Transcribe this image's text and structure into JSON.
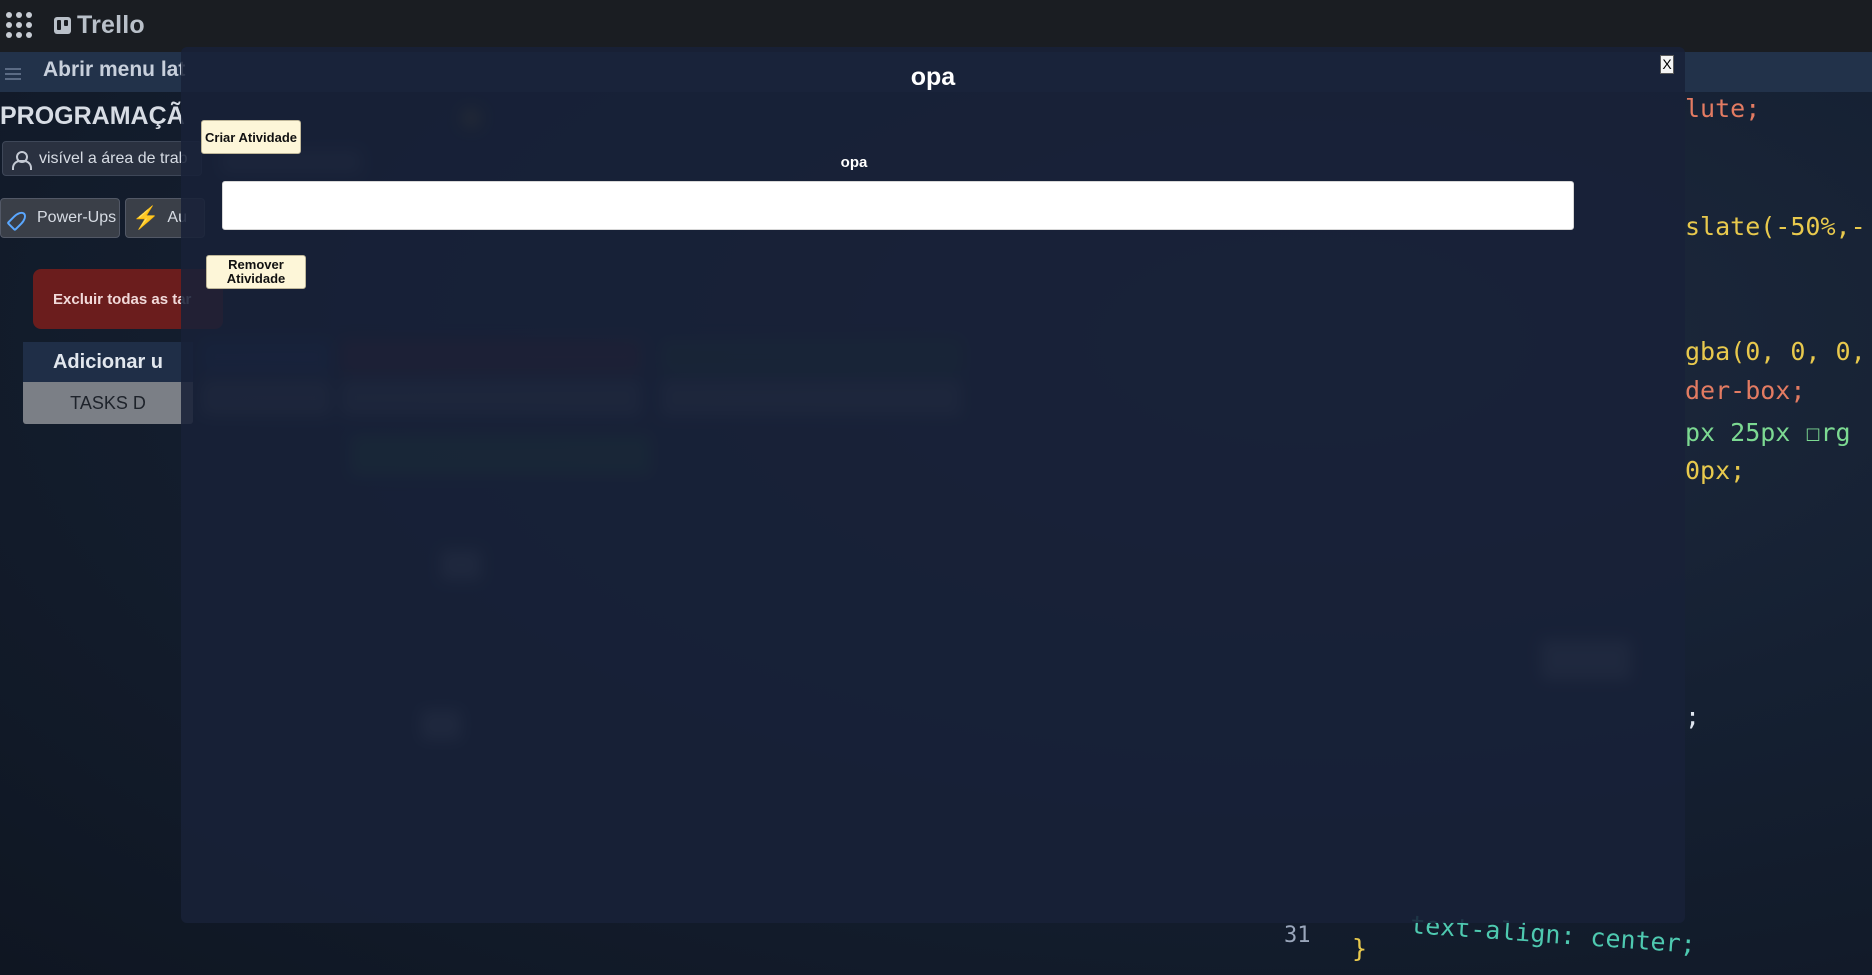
{
  "topbar": {
    "app_name": "Trello"
  },
  "subbar": {
    "menu_label": "Abrir menu lat"
  },
  "board": {
    "title": "PROGRAMAÇÃ",
    "visibility": "visível a área de trab",
    "powerups_label": "Power-Ups",
    "automation_label": "Au",
    "delete_all_label": "Excluir todas as tar",
    "add_column_label": "Adicionar u",
    "tasks_label": "TASKS D"
  },
  "code": {
    "line1": "lute;",
    "line2": "slate(-50%,-",
    "line3": "gba(0, 0, 0,",
    "line4": "der-box;",
    "line5": "px 25px ☐rg",
    "line6": "0px;",
    "line7": ";",
    "line8_num": "31",
    "line8": "text-align: center;",
    "line9": "}"
  },
  "modal": {
    "title": "opa",
    "close_label": "X",
    "create_button": "Criar Atividade",
    "activity_label": "opa",
    "activity_input_value": "",
    "remove_button_line1": "Remover",
    "remove_button_line2": "Atividade"
  },
  "colors": {
    "modal_bg": "#182138",
    "button_bg": "#fdf6d8",
    "delete_button_bg": "#6b1d1d",
    "topbar_bg": "#1a1d22"
  }
}
